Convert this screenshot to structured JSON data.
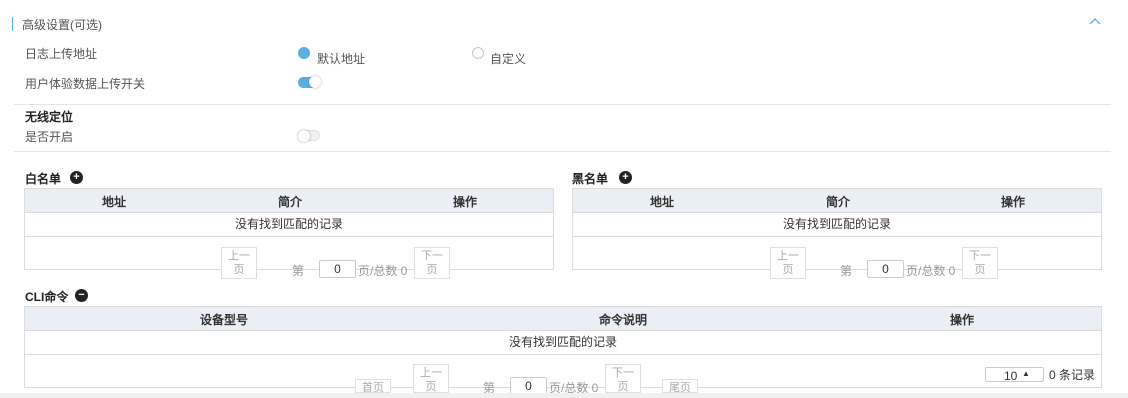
{
  "advanced": {
    "title": "高级设置(可选)",
    "log_upload_label": "日志上传地址",
    "option_default": "默认地址",
    "option_custom": "自定义",
    "ux_upload_label": "用户体验数据上传开关",
    "ux_upload_on": true
  },
  "wireless": {
    "title": "无线定位",
    "enable_label": "是否开启",
    "enabled": false
  },
  "whitelist": {
    "title": "白名单",
    "columns": [
      "地址",
      "简介",
      "操作"
    ],
    "empty_text": "没有找到匹配的记录",
    "prev": "上一\n页",
    "next": "下一\n页",
    "page_prefix": "第",
    "page_value": "0",
    "page_suffix": "页/总数 0"
  },
  "blacklist": {
    "title": "黑名单",
    "columns": [
      "地址",
      "简介",
      "操作"
    ],
    "empty_text": "没有找到匹配的记录",
    "prev": "上一\n页",
    "next": "下一\n页",
    "page_prefix": "第",
    "page_value": "0",
    "page_suffix": "页/总数 0"
  },
  "cli": {
    "title": "CLI命令",
    "columns": [
      "设备型号",
      "命令说明",
      "操作"
    ],
    "empty_text": "没有找到匹配的记录",
    "first": "首页",
    "prev": "上一\n页",
    "next": "下一\n页",
    "last": "尾页",
    "page_prefix": "第",
    "page_value": "0",
    "page_suffix": "页/总数 0",
    "page_size": "10",
    "records_label": "0 条记录"
  },
  "colors": {
    "accent": "#5aaee0",
    "header_bg": "#e9eff5"
  },
  "icons": {
    "collapse": "chevron-up-icon",
    "add": "plus-circle-icon",
    "remove": "minus-circle-icon"
  }
}
